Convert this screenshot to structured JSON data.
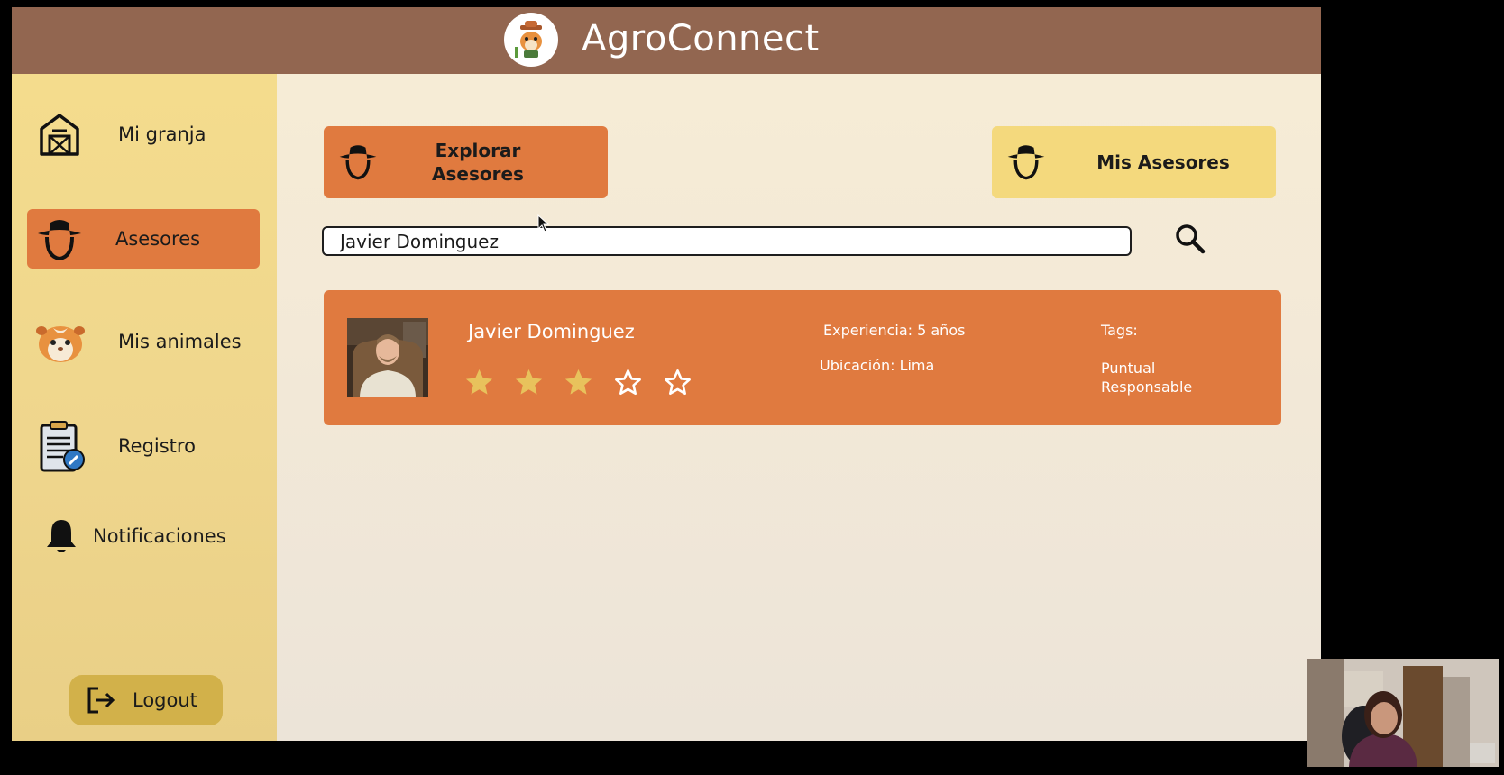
{
  "app": {
    "title": "AgroConnect",
    "logo_icon": "guinea-pig-farmer-logo"
  },
  "colors": {
    "topbar": "#926650",
    "accent": "#e07a3f",
    "sidebar": "#f4dc8d",
    "secondary_button": "#f4d97d",
    "logout": "#d2b14a"
  },
  "sidebar": {
    "items": [
      {
        "label": "Mi granja",
        "icon": "barn-icon",
        "active": false
      },
      {
        "label": "Asesores",
        "icon": "farmer-hat-icon",
        "active": true
      },
      {
        "label": "Mis animales",
        "icon": "guinea-pig-icon",
        "active": false
      },
      {
        "label": "Registro",
        "icon": "clipboard-edit-icon",
        "active": false
      },
      {
        "label": "Notificaciones",
        "icon": "bell-icon",
        "active": false
      }
    ],
    "logout_label": "Logout"
  },
  "tabs": {
    "explore_label_line1": "Explorar",
    "explore_label_line2": "Asesores",
    "mine_label": "Mis Asesores"
  },
  "search": {
    "value": "Javier Dominguez"
  },
  "results": [
    {
      "name": "Javier Dominguez",
      "rating": 3,
      "rating_max": 5,
      "experience": "Experiencia: 5 años",
      "location": "Ubicación: Lima",
      "tags_label": "Tags:",
      "tags": [
        "Puntual",
        "Responsable"
      ]
    }
  ]
}
